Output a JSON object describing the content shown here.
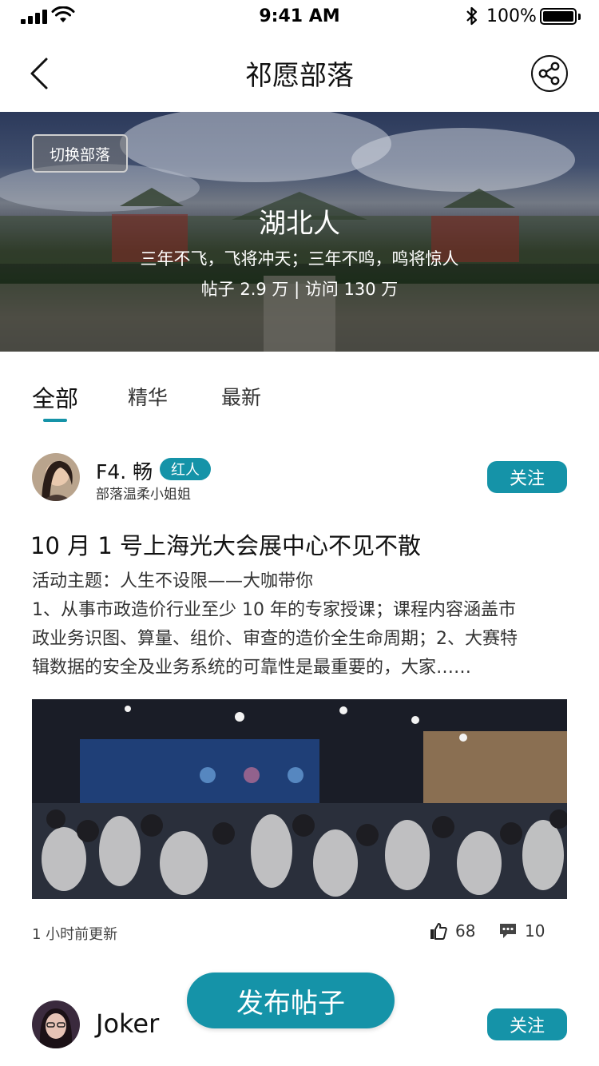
{
  "status_bar": {
    "time": "9:41 AM",
    "battery": "100%"
  },
  "nav": {
    "title": "祁愿部落"
  },
  "banner": {
    "switch_label": "切换部落",
    "tribe_name": "湖北人",
    "motto": "三年不飞，飞将冲天；三年不鸣，鸣将惊人",
    "stats": "帖子 2.9 万 | 访问 130 万"
  },
  "tabs": [
    {
      "label": "全部",
      "active": true
    },
    {
      "label": "精华",
      "active": false
    },
    {
      "label": "最新",
      "active": false
    }
  ],
  "posts": [
    {
      "author": "F4. 畅",
      "badge": "红人",
      "subtitle": "部落温柔小姐姐",
      "follow_label": "关注",
      "title": "10 月 1 号上海光大会展中心不见不散",
      "body_lines": [
        "活动主题：人生不设限——大咖带你",
        "1、从事市政造价行业至少 10 年的专家授课；课程内容涵盖市",
        "政业务识图、算量、组价、审查的造价全生命周期；2、大赛特",
        "辑数据的安全及业务系统的可靠性是最重要的，大家……"
      ],
      "time": "1 小时前更新",
      "likes": "68",
      "comments": "10"
    },
    {
      "author": "Joker",
      "follow_label": "关注"
    }
  ],
  "publish_label": "发布帖子",
  "colors": {
    "accent": "#1593a8"
  },
  "icons": [
    "signal-icon",
    "wifi-icon",
    "bluetooth-icon",
    "battery-icon",
    "back-icon",
    "share-icon",
    "thumbs-up-icon",
    "comment-icon"
  ]
}
